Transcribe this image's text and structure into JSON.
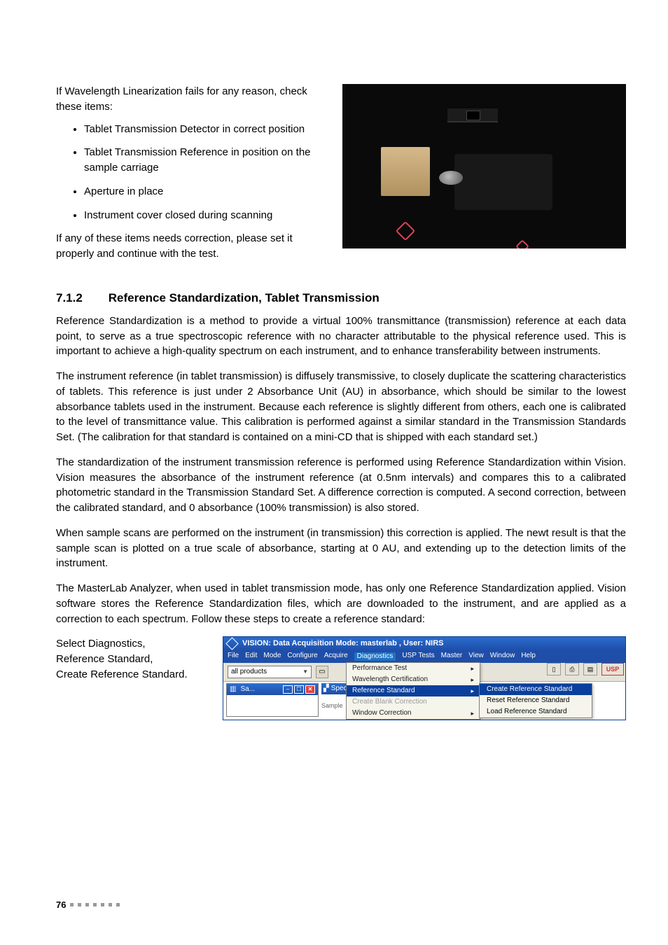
{
  "top": {
    "intro": "If Wavelength Linearization fails for any reason, check these items:",
    "bullets": [
      "Tablet Transmission Detector in correct position",
      "Tablet Transmission Reference in position on the sample carriage",
      "Aperture in place",
      "Instrument cover closed during scanning"
    ],
    "outro": "If any of these items needs correction, please set it properly and continue with the test."
  },
  "section": {
    "number": "7.1.2",
    "title": "Reference Standardization, Tablet Transmission",
    "p1": "Reference Standardization is a method to provide a virtual 100% transmittance (transmission) reference at each data point, to serve as a true spectroscopic reference with no character attributable to the physical reference used. This is important to achieve a high-quality spectrum on each instrument, and to enhance transferability between instruments.",
    "p2": "The instrument reference (in tablet transmission) is diffusely transmissive, to closely duplicate the scattering characteristics of tablets. This reference is just under 2 Absorbance Unit (AU) in absorbance, which should be similar to the lowest absorbance tablets used in the instrument. Because each reference is slightly different from others, each one is calibrated to the level of transmittance value. This calibration is performed against a similar standard in the Transmission Standards Set. (The calibration for that standard is contained on a mini-CD that is shipped with each standard set.)",
    "p3": "The standardization of the instrument transmission reference is performed using Reference Standardization within Vision. Vision measures the absorbance of the instrument reference (at 0.5nm intervals) and compares this to a calibrated photometric standard in the Transmission Standard Set. A difference correction is computed. A second correction, between the calibrated standard, and 0 absorbance (100% transmission) is also stored.",
    "p4": "When sample scans are performed on the instrument (in transmission) this correction is applied. The newt result is that the sample scan is plotted on a true scale of absorbance, starting at 0 AU, and extending up to the detection limits of the instrument.",
    "p5": "The MasterLab Analyzer, when used in tablet transmission mode, has only one Reference Standardization applied. Vision software stores the Reference Standardization files, which are downloaded to the instrument, and are applied as a correction to each spectrum. Follow these steps to create a reference standard:"
  },
  "bottomLeft": {
    "l1": "Select Diagnostics,",
    "l2": "Reference Standard,",
    "l3": "Create Reference Standard."
  },
  "screenshot": {
    "title": "VISION: Data Acquisition Mode: masterlab , User: NIRS",
    "menu": [
      "File",
      "Edit",
      "Mode",
      "Configure",
      "Acquire",
      "Diagnostics",
      "USP Tests",
      "Master",
      "View",
      "Window",
      "Help"
    ],
    "activeMenu": "Diagnostics",
    "combo": "all products",
    "dropdown": [
      {
        "label": "Performance Test",
        "arrow": true
      },
      {
        "label": "Wavelength Certification",
        "arrow": true
      },
      {
        "label": "Reference Standard",
        "arrow": true,
        "hl": true
      },
      {
        "label": "Create Blank Correction",
        "disabled": true
      },
      {
        "label": "Window Correction",
        "arrow": true
      }
    ],
    "submenu": [
      {
        "label": "Create Reference Standard",
        "hl": true
      },
      {
        "label": "Reset Reference Standard"
      },
      {
        "label": "Load Reference Standard"
      }
    ],
    "usp": "USP",
    "innerTitle": "Sa...",
    "spectr": "Spectr",
    "sample": "Sample"
  },
  "footer": {
    "page": "76"
  }
}
